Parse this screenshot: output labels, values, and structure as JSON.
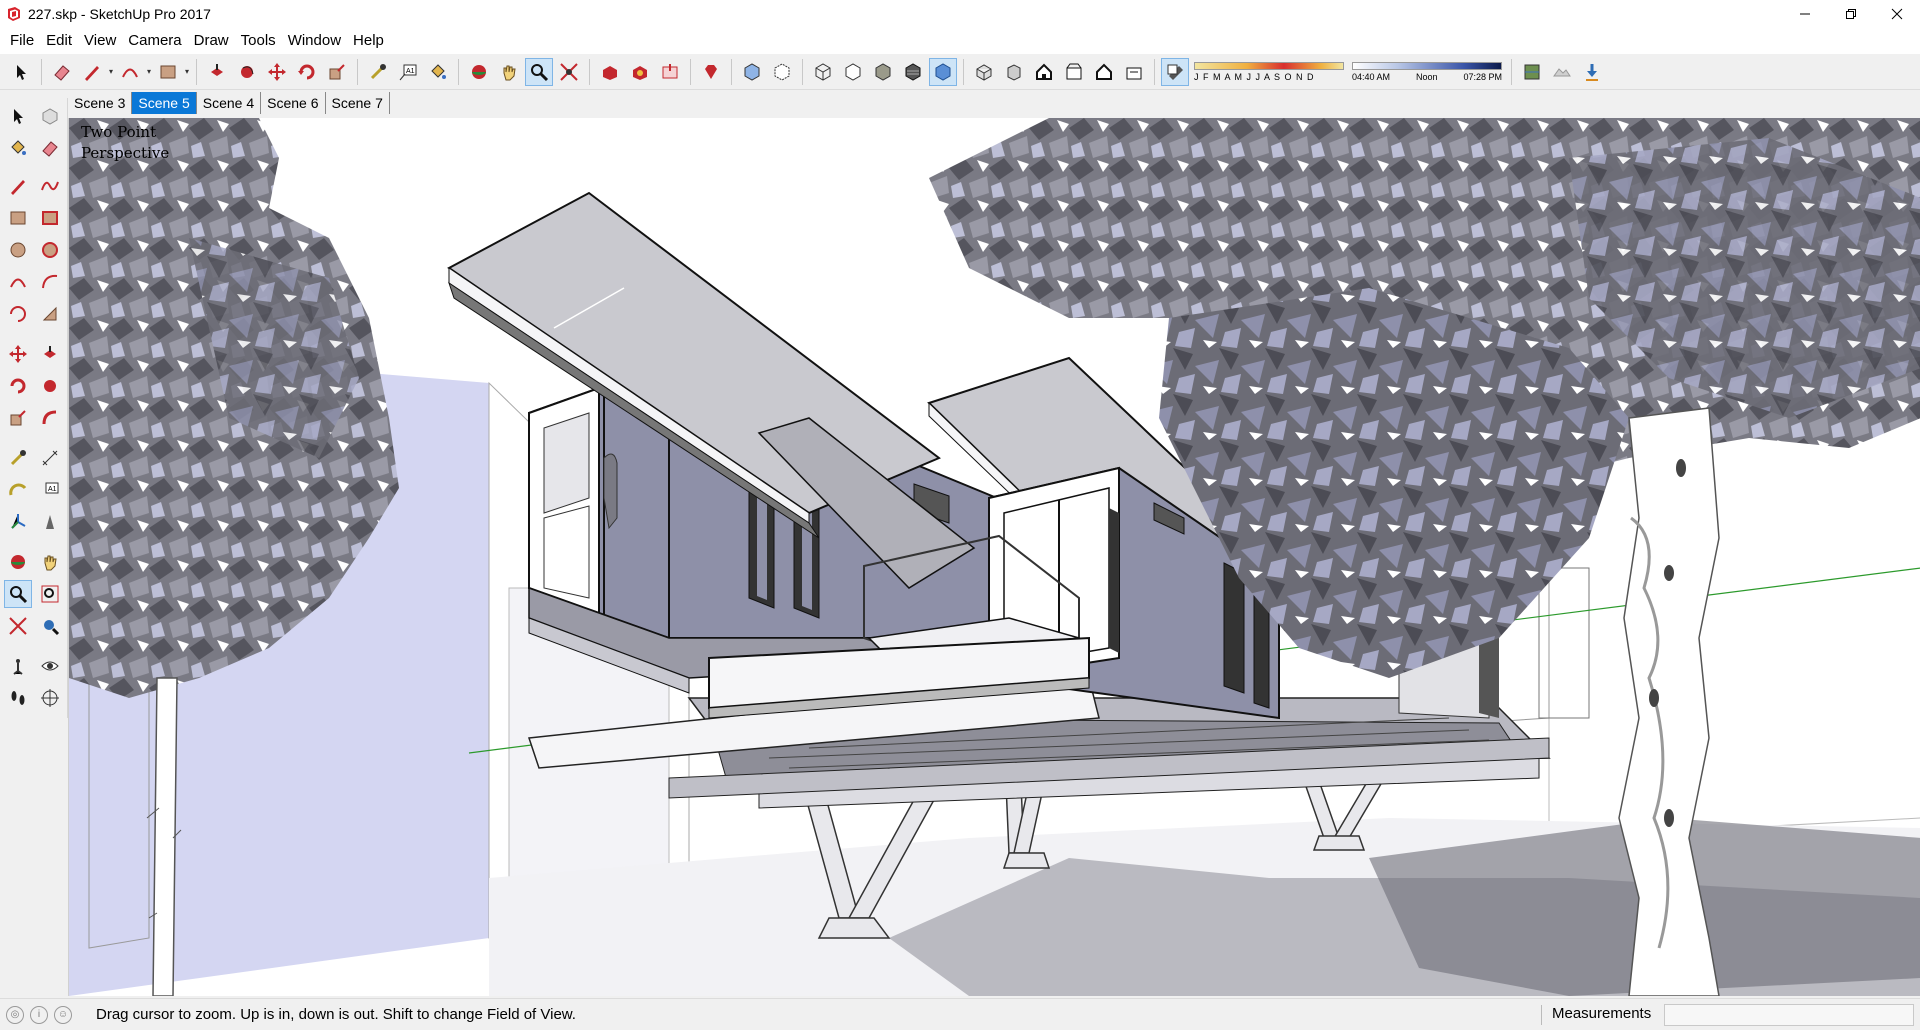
{
  "window": {
    "title": "227.skp - SketchUp Pro 2017",
    "controls": [
      "minimize-icon",
      "maximize-icon",
      "close-icon"
    ]
  },
  "menu": {
    "items": [
      {
        "label": "File"
      },
      {
        "label": "Edit"
      },
      {
        "label": "View"
      },
      {
        "label": "Camera"
      },
      {
        "label": "Draw"
      },
      {
        "label": "Tools"
      },
      {
        "label": "Window"
      },
      {
        "label": "Help"
      }
    ]
  },
  "shadows": {
    "months": "J F M A M J J A S O N D",
    "time_start": "04:40 AM",
    "time_mid": "Noon",
    "time_end": "07:28 PM"
  },
  "scenes": {
    "tabs": [
      {
        "label": "Scene 3",
        "active": false
      },
      {
        "label": "Scene 5",
        "active": true
      },
      {
        "label": "Scene 4",
        "active": false
      },
      {
        "label": "Scene 6",
        "active": false
      },
      {
        "label": "Scene 7",
        "active": false
      }
    ]
  },
  "viewport": {
    "camera_line1": "Two Point",
    "camera_line2": "Perspective"
  },
  "status": {
    "hint": "Drag cursor to zoom.  Up is in, down is out. Shift to change Field of View.",
    "measurements_label": "Measurements",
    "measurements_value": ""
  },
  "colors": {
    "accent": "#0a78d7",
    "active_tool_bg": "#cde4f7",
    "facade": "#8e90a8",
    "foliage": "#6f6f78",
    "sky_wall": "#d4d6f2"
  }
}
